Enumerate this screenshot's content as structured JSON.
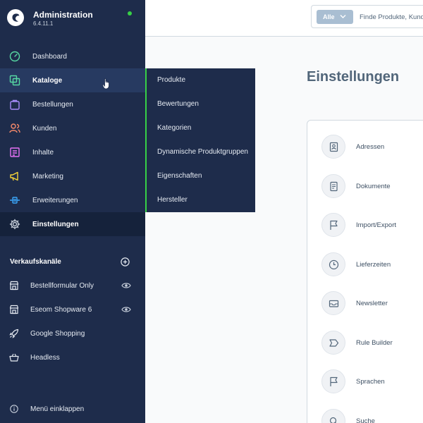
{
  "app": {
    "title": "Administration",
    "version": "6.4.11.1",
    "status_color": "#37d046"
  },
  "sidebar": {
    "items": [
      {
        "label": "Dashboard",
        "icon": "gauge-icon"
      },
      {
        "label": "Kataloge",
        "icon": "catalog-icon"
      },
      {
        "label": "Bestellungen",
        "icon": "shopping-bag-icon"
      },
      {
        "label": "Kunden",
        "icon": "users-icon"
      },
      {
        "label": "Inhalte",
        "icon": "content-icon"
      },
      {
        "label": "Marketing",
        "icon": "megaphone-icon"
      },
      {
        "label": "Erweiterungen",
        "icon": "plug-icon"
      },
      {
        "label": "Einstellungen",
        "icon": "gear-icon"
      }
    ],
    "sales_channels_heading": "Verkaufskanäle",
    "sales_channels": [
      {
        "label": "Bestellformular Only",
        "icon": "storefront-icon"
      },
      {
        "label": "Eseom Shopware 6",
        "icon": "storefront-icon"
      },
      {
        "label": "Google Shopping",
        "icon": "rocket-icon"
      },
      {
        "label": "Headless",
        "icon": "basket-icon"
      }
    ],
    "collapse_label": "Menü einklappen"
  },
  "flyout": {
    "items": [
      "Produkte",
      "Bewertungen",
      "Kategorien",
      "Dynamische Produktgruppen",
      "Eigenschaften",
      "Hersteller"
    ]
  },
  "search": {
    "type_label": "Alle",
    "placeholder": "Finde Produkte, Kunden, Bestellungen..."
  },
  "page": {
    "title": "Einstellungen",
    "settings": [
      {
        "label": "Adressen",
        "icon": "address-book-icon"
      },
      {
        "label": "Dokumente",
        "icon": "document-icon"
      },
      {
        "label": "Import/Export",
        "icon": "flag-icon"
      },
      {
        "label": "Lieferzeiten",
        "icon": "clock-icon"
      },
      {
        "label": "Newsletter",
        "icon": "envelope-icon"
      },
      {
        "label": "Rule Builder",
        "icon": "tag-icon"
      },
      {
        "label": "Sprachen",
        "icon": "flag-icon"
      },
      {
        "label": "Suche",
        "icon": "search-icon"
      }
    ]
  }
}
